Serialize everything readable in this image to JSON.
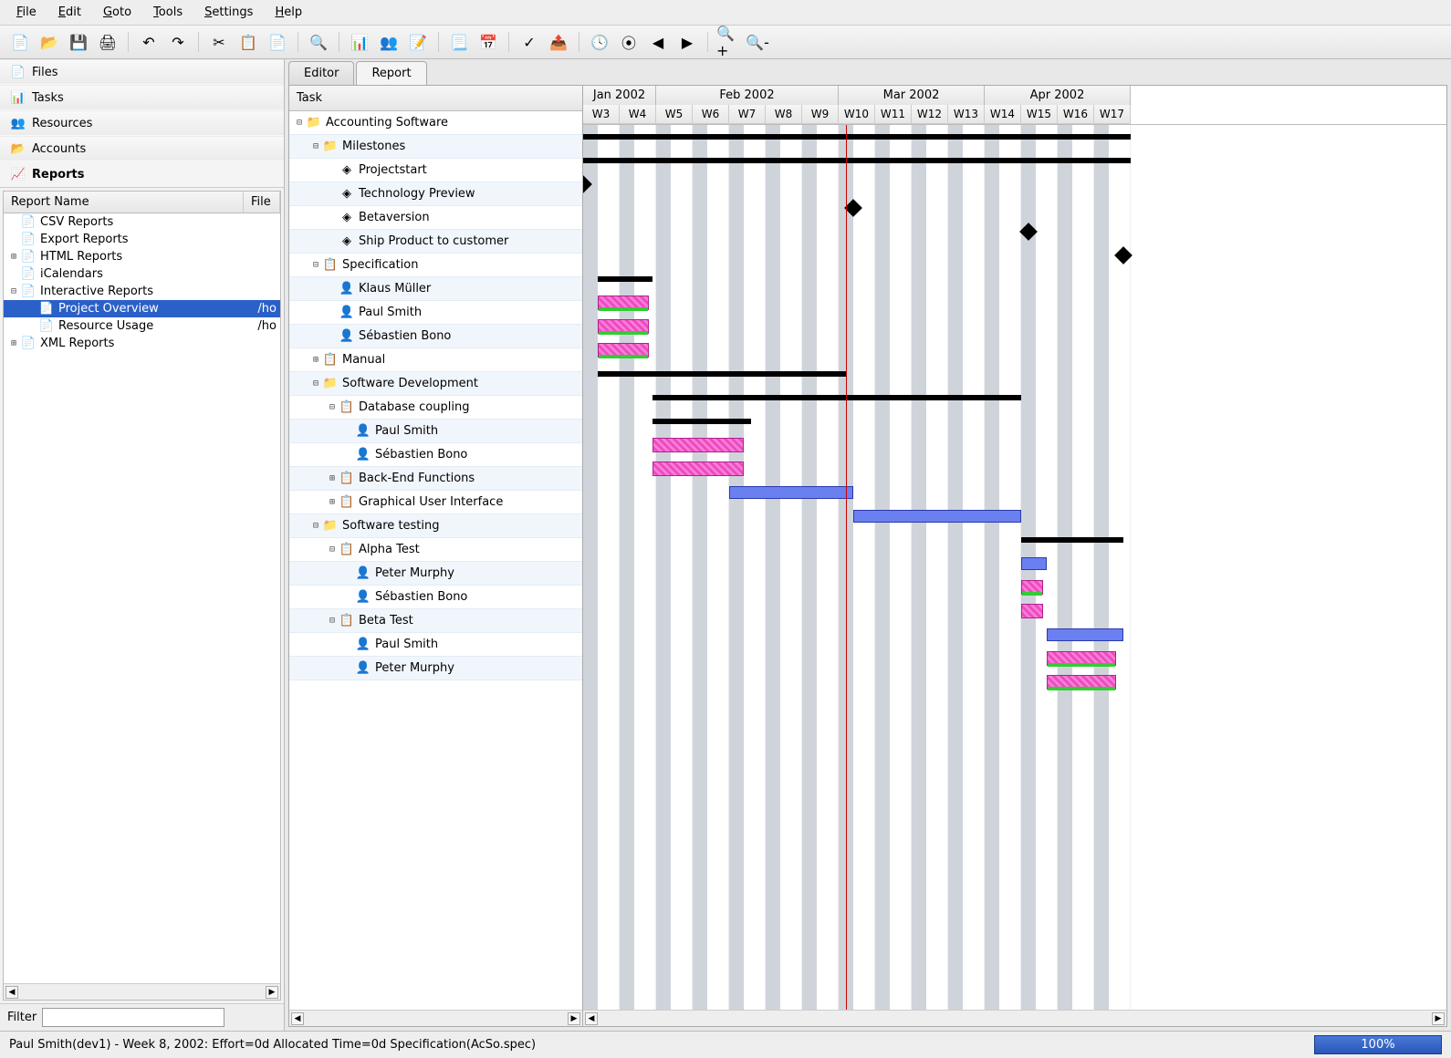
{
  "menu": [
    "File",
    "Edit",
    "Goto",
    "Tools",
    "Settings",
    "Help"
  ],
  "menu_accel": [
    0,
    0,
    0,
    0,
    0,
    0
  ],
  "toolbar_icons": [
    "new-file",
    "open-file",
    "save",
    "print",
    "sep",
    "undo",
    "redo",
    "sep",
    "cut",
    "copy",
    "paste",
    "sep",
    "find",
    "sep",
    "tasks",
    "resources",
    "new-task",
    "sep",
    "list-view",
    "gantt-view",
    "sep",
    "validate",
    "export",
    "sep",
    "goto-today",
    "nav-first",
    "nav-prev",
    "nav-next",
    "sep",
    "zoom-in",
    "zoom-out"
  ],
  "sidebar": {
    "items": [
      {
        "id": "files",
        "label": "Files",
        "icon": "file-icon"
      },
      {
        "id": "tasks",
        "label": "Tasks",
        "icon": "task-icon"
      },
      {
        "id": "resources",
        "label": "Resources",
        "icon": "resource-icon"
      },
      {
        "id": "accounts",
        "label": "Accounts",
        "icon": "account-icon"
      },
      {
        "id": "reports",
        "label": "Reports",
        "icon": "report-icon",
        "selected": true
      }
    ],
    "report_cols": [
      "Report Name",
      "File"
    ],
    "reports": [
      {
        "lvl": 0,
        "tw": "",
        "icon": "csv",
        "label": "CSV Reports"
      },
      {
        "lvl": 0,
        "tw": "",
        "icon": "export",
        "label": "Export Reports"
      },
      {
        "lvl": 0,
        "tw": "⊞",
        "icon": "html",
        "label": "HTML Reports"
      },
      {
        "lvl": 0,
        "tw": "",
        "icon": "ical",
        "label": "iCalendars"
      },
      {
        "lvl": 0,
        "tw": "⊟",
        "icon": "interactive",
        "label": "Interactive Reports"
      },
      {
        "lvl": 1,
        "tw": "",
        "icon": "overview",
        "label": "Project Overview",
        "file": "/ho",
        "sel": true
      },
      {
        "lvl": 1,
        "tw": "",
        "icon": "resusage",
        "label": "Resource Usage",
        "file": "/ho"
      },
      {
        "lvl": 0,
        "tw": "⊞",
        "icon": "xml",
        "label": "XML Reports"
      }
    ]
  },
  "filter_label": "Filter",
  "tabs": [
    "Editor",
    "Report"
  ],
  "active_tab": 1,
  "task_header": "Task",
  "tasks": [
    {
      "lvl": 0,
      "tw": "⊟",
      "icon": "proj",
      "label": "Accounting Software",
      "type": "sum",
      "s": 0,
      "e": 15
    },
    {
      "lvl": 1,
      "tw": "⊟",
      "icon": "proj",
      "label": "Milestones",
      "type": "sum",
      "s": 0,
      "e": 15
    },
    {
      "lvl": 2,
      "tw": "",
      "icon": "ms",
      "label": "Projectstart",
      "type": "ms",
      "s": 0
    },
    {
      "lvl": 2,
      "tw": "",
      "icon": "ms",
      "label": "Technology Preview",
      "type": "ms",
      "s": 7.4
    },
    {
      "lvl": 2,
      "tw": "",
      "icon": "ms",
      "label": "Betaversion",
      "type": "ms",
      "s": 12.2
    },
    {
      "lvl": 2,
      "tw": "",
      "icon": "ms",
      "label": "Ship Product to customer",
      "type": "ms",
      "s": 14.8
    },
    {
      "lvl": 1,
      "tw": "⊟",
      "icon": "task",
      "label": "Specification",
      "type": "sum",
      "s": 0.4,
      "e": 1.9
    },
    {
      "lvl": 2,
      "tw": "",
      "icon": "res",
      "label": "Klaus Müller",
      "type": "res",
      "s": 0.4,
      "e": 1.8,
      "green": true
    },
    {
      "lvl": 2,
      "tw": "",
      "icon": "res",
      "label": "Paul Smith",
      "type": "res",
      "s": 0.4,
      "e": 1.8,
      "green": true
    },
    {
      "lvl": 2,
      "tw": "",
      "icon": "res",
      "label": "Sébastien Bono",
      "type": "res",
      "s": 0.4,
      "e": 1.8,
      "green": true
    },
    {
      "lvl": 1,
      "tw": "⊞",
      "icon": "task",
      "label": "Manual",
      "type": "sum",
      "s": 0.4,
      "e": 7.2
    },
    {
      "lvl": 1,
      "tw": "⊟",
      "icon": "proj",
      "label": "Software Development",
      "type": "sum",
      "s": 1.9,
      "e": 12
    },
    {
      "lvl": 2,
      "tw": "⊟",
      "icon": "task",
      "label": "Database coupling",
      "type": "sum",
      "s": 1.9,
      "e": 4.6
    },
    {
      "lvl": 3,
      "tw": "",
      "icon": "res",
      "label": "Paul Smith",
      "type": "res",
      "s": 1.9,
      "e": 4.4
    },
    {
      "lvl": 3,
      "tw": "",
      "icon": "res",
      "label": "Sébastien Bono",
      "type": "res",
      "s": 1.9,
      "e": 4.4
    },
    {
      "lvl": 2,
      "tw": "⊞",
      "icon": "task",
      "label": "Back-End Functions",
      "type": "task",
      "s": 4.0,
      "e": 7.4
    },
    {
      "lvl": 2,
      "tw": "⊞",
      "icon": "task",
      "label": "Graphical User Interface",
      "type": "task",
      "s": 7.4,
      "e": 12
    },
    {
      "lvl": 1,
      "tw": "⊟",
      "icon": "proj",
      "label": "Software testing",
      "type": "sum",
      "s": 12,
      "e": 14.8
    },
    {
      "lvl": 2,
      "tw": "⊟",
      "icon": "task",
      "label": "Alpha Test",
      "type": "task",
      "s": 12,
      "e": 12.7
    },
    {
      "lvl": 3,
      "tw": "",
      "icon": "res",
      "label": "Peter Murphy",
      "type": "res",
      "s": 12,
      "e": 12.6,
      "green": true
    },
    {
      "lvl": 3,
      "tw": "",
      "icon": "res",
      "label": "Sébastien Bono",
      "type": "res",
      "s": 12,
      "e": 12.6
    },
    {
      "lvl": 2,
      "tw": "⊟",
      "icon": "task",
      "label": "Beta Test",
      "type": "task",
      "s": 12.7,
      "e": 14.8
    },
    {
      "lvl": 3,
      "tw": "",
      "icon": "res",
      "label": "Paul Smith",
      "type": "res",
      "s": 12.7,
      "e": 14.6,
      "green": true
    },
    {
      "lvl": 3,
      "tw": "",
      "icon": "res",
      "label": "Peter Murphy",
      "type": "res",
      "s": 12.7,
      "e": 14.6,
      "green": true
    }
  ],
  "timeline": {
    "months": [
      {
        "label": "Jan 2002",
        "span": 2
      },
      {
        "label": "Feb 2002",
        "span": 5
      },
      {
        "label": "Mar 2002",
        "span": 4
      },
      {
        "label": "Apr 2002",
        "span": 4
      }
    ],
    "weeks": [
      "W3",
      "W4",
      "W5",
      "W6",
      "W7",
      "W8",
      "W9",
      "W10",
      "W11",
      "W12",
      "W13",
      "W14",
      "W15",
      "W16",
      "W17"
    ],
    "today_week": 7.2
  },
  "status": {
    "text": "Paul Smith(dev1) - Week 8, 2002:  Effort=0d  Allocated Time=0d  Specification(AcSo.spec)",
    "progress": "100%"
  },
  "chart_data": {
    "type": "gantt",
    "x_unit": "week",
    "x_start": "2002-W03",
    "x_end": "2002-W17",
    "tasks": [
      {
        "name": "Accounting Software",
        "type": "summary",
        "start": "W3",
        "end": "W17"
      },
      {
        "name": "Milestones",
        "type": "summary",
        "start": "W3",
        "end": "W17"
      },
      {
        "name": "Projectstart",
        "type": "milestone",
        "date": "W3"
      },
      {
        "name": "Technology Preview",
        "type": "milestone",
        "date": "W10"
      },
      {
        "name": "Betaversion",
        "type": "milestone",
        "date": "W15"
      },
      {
        "name": "Ship Product to customer",
        "type": "milestone",
        "date": "W17"
      },
      {
        "name": "Specification",
        "type": "summary",
        "start": "W3",
        "end": "W5",
        "resources": [
          "Klaus Müller",
          "Paul Smith",
          "Sébastien Bono"
        ]
      },
      {
        "name": "Manual",
        "type": "summary",
        "start": "W3",
        "end": "W10"
      },
      {
        "name": "Software Development",
        "type": "summary",
        "start": "W5",
        "end": "W15"
      },
      {
        "name": "Database coupling",
        "type": "task",
        "start": "W5",
        "end": "W8",
        "resources": [
          "Paul Smith",
          "Sébastien Bono"
        ]
      },
      {
        "name": "Back-End Functions",
        "type": "task",
        "start": "W7",
        "end": "W10"
      },
      {
        "name": "Graphical User Interface",
        "type": "task",
        "start": "W10",
        "end": "W15"
      },
      {
        "name": "Software testing",
        "type": "summary",
        "start": "W15",
        "end": "W17"
      },
      {
        "name": "Alpha Test",
        "type": "task",
        "start": "W15",
        "end": "W15",
        "resources": [
          "Peter Murphy",
          "Sébastien Bono"
        ]
      },
      {
        "name": "Beta Test",
        "type": "task",
        "start": "W15",
        "end": "W17",
        "resources": [
          "Paul Smith",
          "Peter Murphy"
        ]
      }
    ],
    "current_date": "W10"
  }
}
